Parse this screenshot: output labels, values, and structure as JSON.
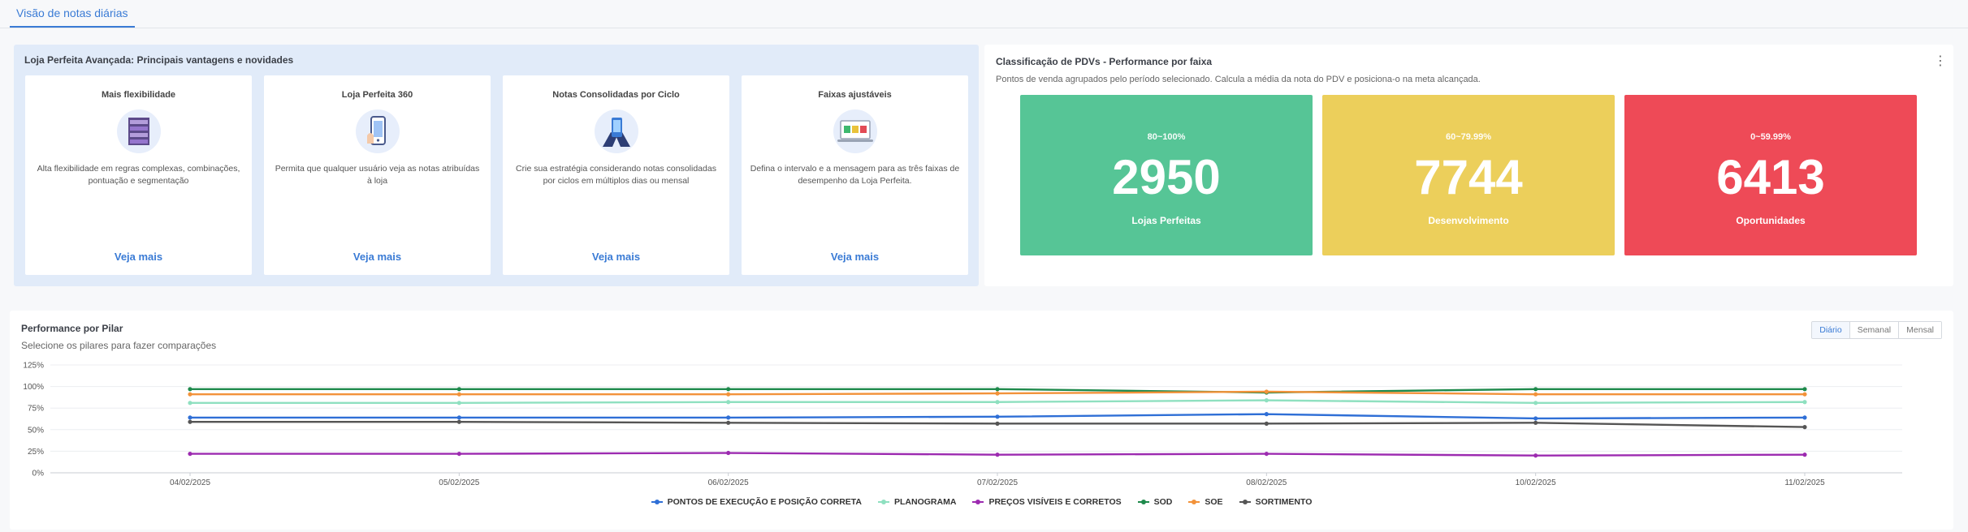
{
  "tabs": [
    {
      "label": "Visão de notas diárias",
      "active": true
    }
  ],
  "advantages": {
    "title": "Loja Perfeita Avançada: Principais vantagens e novidades",
    "cards": [
      {
        "title": "Mais flexibilidade",
        "icon": "shelf-icon",
        "text": "Alta flexibilidade em regras complexas, combinações, pontuação e segmentação",
        "link": "Veja mais"
      },
      {
        "title": "Loja Perfeita 360",
        "icon": "phone-icon",
        "text": "Permita que qualquer usuário veja as notas atribuídas à loja",
        "link": "Veja mais"
      },
      {
        "title": "Notas Consolidadas por Ciclo",
        "icon": "hand-phone-icon",
        "text": "Crie sua estratégia considerando notas consolidadas por ciclos em múltiplos dias ou mensal",
        "link": "Veja mais"
      },
      {
        "title": "Faixas ajustáveis",
        "icon": "laptop-icon",
        "text": "Defina o intervalo e a mensagem para as três faixas de desempenho da Loja Perfeita.",
        "link": "Veja mais"
      }
    ]
  },
  "classification": {
    "title": "Classificação de PDVs - Performance por faixa",
    "subtitle": "Pontos de venda agrupados pelo período selecionado. Calcula a média da nota do PDV e posiciona-o na meta alcançada.",
    "bands": [
      {
        "range": "80~100%",
        "value": "2950",
        "label": "Lojas Perfeitas",
        "color": "#56c596"
      },
      {
        "range": "60~79.99%",
        "value": "7744",
        "label": "Desenvolvimento",
        "color": "#eccf5b"
      },
      {
        "range": "0~59.99%",
        "value": "6413",
        "label": "Oportunidades",
        "color": "#ee4a57"
      }
    ]
  },
  "performance": {
    "title": "Performance por Pilar",
    "subtitle": "Selecione os pilares para fazer comparações",
    "periods": [
      "Diário",
      "Semanal",
      "Mensal"
    ],
    "active_period": "Diário"
  },
  "chart_data": {
    "type": "line",
    "x": [
      "04/02/2025",
      "05/02/2025",
      "06/02/2025",
      "07/02/2025",
      "08/02/2025",
      "10/02/2025",
      "11/02/2025"
    ],
    "y_ticks": [
      "0%",
      "25%",
      "50%",
      "75%",
      "100%",
      "125%"
    ],
    "ylim": [
      0,
      125
    ],
    "grid": true,
    "legend_position": "bottom",
    "series": [
      {
        "name": "PONTOS DE EXECUÇÃO E POSIÇÃO CORRETA",
        "color": "#2f6fd6",
        "values": [
          64,
          64,
          64,
          65,
          68,
          63,
          64
        ]
      },
      {
        "name": "PLANOGRAMA",
        "color": "#8fe0c0",
        "values": [
          81,
          81,
          82,
          82,
          84,
          81,
          82
        ]
      },
      {
        "name": "PREÇOS VISÍVEIS E CORRETOS",
        "color": "#9c2bb0",
        "values": [
          22,
          22,
          23,
          21,
          22,
          20,
          21
        ]
      },
      {
        "name": "SOD",
        "color": "#1f8a4c",
        "values": [
          97,
          97,
          97,
          97,
          93,
          97,
          97
        ]
      },
      {
        "name": "SOE",
        "color": "#f2923a",
        "values": [
          91,
          91,
          91,
          92,
          94,
          91,
          91
        ]
      },
      {
        "name": "SORTIMENTO",
        "color": "#555555",
        "values": [
          59,
          59,
          58,
          57,
          57,
          58,
          53
        ]
      }
    ]
  }
}
